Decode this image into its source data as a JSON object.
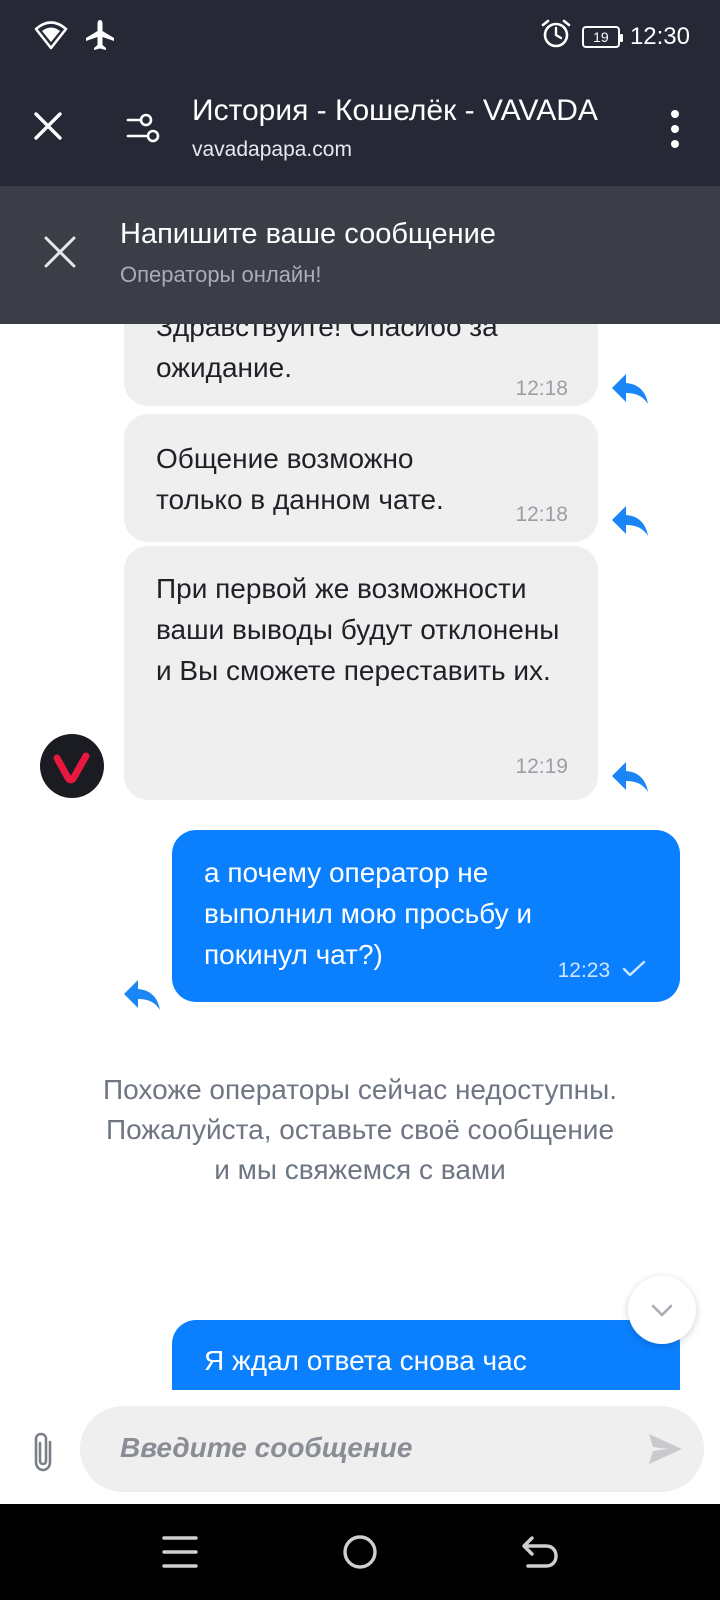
{
  "status_bar": {
    "time": "12:30",
    "battery_level": "19",
    "icons": [
      "wifi-icon",
      "airplane-icon",
      "alarm-icon",
      "battery-icon"
    ]
  },
  "browser": {
    "title": "История - Кошелёк - VAVADA",
    "url": "vavadapapa.com"
  },
  "chat_header": {
    "title": "Напишите ваше сообщение",
    "subtitle": "Операторы онлайн!"
  },
  "messages": {
    "m1": {
      "text": "Здравствуйте! Спасибо за ожидание.",
      "time": "12:18",
      "side": "incoming"
    },
    "m2": {
      "text": "Общение возможно только в данном чате.",
      "time": "12:18",
      "side": "incoming"
    },
    "m3": {
      "text": "При первой же возможности ваши выводы будут отклонены и Вы сможете переставить их.",
      "time": "12:19",
      "side": "incoming"
    },
    "m4": {
      "text": "а почему оператор не выполнил мою просьбу и покинул чат?)",
      "time": "12:23",
      "side": "outgoing",
      "status": "sent"
    },
    "m5": {
      "text": "Я ждал ответа снова час",
      "side": "outgoing"
    }
  },
  "system_message": "Похоже операторы сейчас недоступны. Пожалуйста, оставьте своё сообщение и мы свяжемся с вами",
  "composer": {
    "placeholder": "Введите сообщение"
  },
  "colors": {
    "bar_dark": "#262836",
    "chat_header": "#3b3e47",
    "bubble_incoming": "#efeff0",
    "bubble_outgoing": "#0b80ff",
    "accent": "#0b80ff",
    "brand_red": "#e8183f"
  }
}
